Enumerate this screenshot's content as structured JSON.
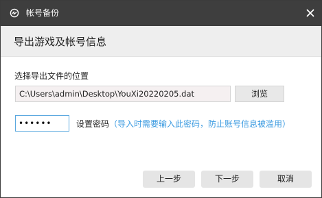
{
  "window": {
    "title": "帐号备份",
    "icon": "backup-app-icon",
    "close_icon": "close-icon"
  },
  "header": {
    "title": "导出游戏及帐号信息"
  },
  "export": {
    "location_label": "选择导出文件的位置",
    "path_value": "C:\\Users\\admin\\Desktop\\YouXi20220205.dat",
    "browse_label": "浏览"
  },
  "password": {
    "value": "••••••",
    "label": "设置密码",
    "hint": "（导入时需要输入此密码，防止账号信息被滥用）"
  },
  "footer": {
    "prev_label": "上一步",
    "next_label": "下一步",
    "cancel_label": "取消"
  },
  "colors": {
    "titlebar": "#3e3e3e",
    "header_band": "#eeeeee",
    "hint_text": "#3a9ae0",
    "focus_border": "#5aa8df"
  }
}
